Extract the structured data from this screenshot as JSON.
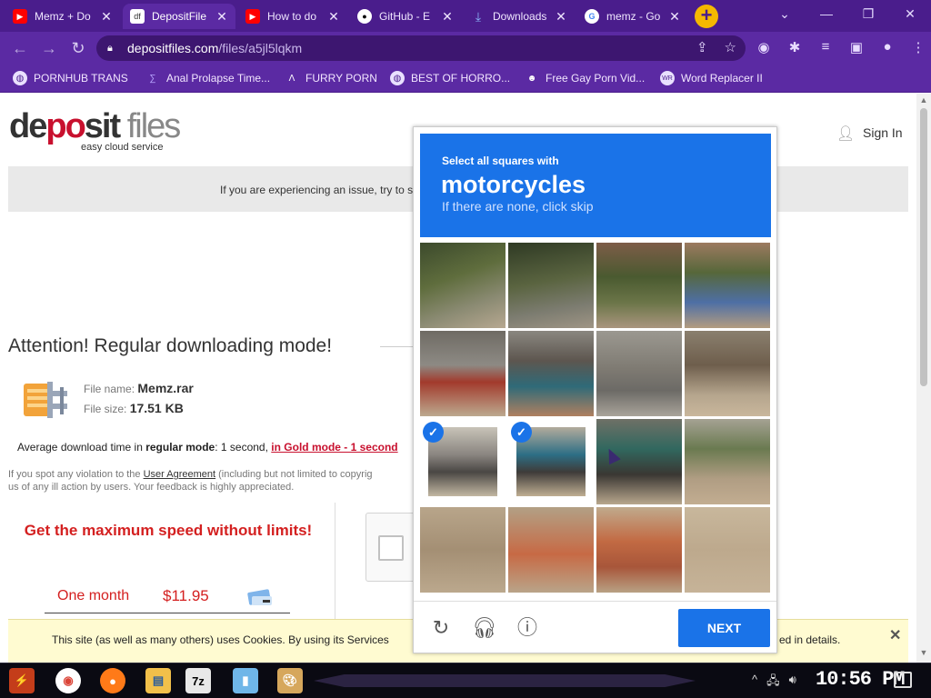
{
  "browser": {
    "tabs": [
      {
        "label": "Memz + Do",
        "icon": "youtube-icon",
        "color": "#ff0000"
      },
      {
        "label": "DepositFile",
        "icon": "depositfiles-icon",
        "color": "#ffffff"
      },
      {
        "label": "How to do",
        "icon": "youtube-icon",
        "color": "#ff0000"
      },
      {
        "label": "GitHub - E",
        "icon": "github-icon",
        "color": "#ffffff"
      },
      {
        "label": "Downloads",
        "icon": "download-icon",
        "color": "#4285f4"
      },
      {
        "label": "memz - Go",
        "icon": "google-icon",
        "color": "#ffffff"
      }
    ],
    "url_domain": "depositfiles.com",
    "url_path": "/files/a5jl5lqkm",
    "bookmarks": [
      {
        "label": "PORNHUB TRANS",
        "icon": "globe-icon"
      },
      {
        "label": "Anal Prolapse Time...",
        "icon": "bookmark-icon"
      },
      {
        "label": "FURRY PORN",
        "icon": "lambda-icon"
      },
      {
        "label": "BEST OF HORRO...",
        "icon": "globe-icon"
      },
      {
        "label": "Free Gay Porn Vid...",
        "icon": "bookmark-icon"
      },
      {
        "label": "Word Replacer II",
        "icon": "extension-icon"
      }
    ]
  },
  "site": {
    "logo_part1": "de",
    "logo_part2": "po",
    "logo_part3": "sit",
    "logo_part4": " files",
    "tagline": "easy cloud service",
    "signin": "Sign In",
    "banner_text": "If you are experiencing an issue, try to s",
    "heading": "Attention! Regular downloading mode!",
    "file_name_label": "File name:",
    "file_name": "Memz.rar",
    "file_size_label": "File size:",
    "file_size": "17.51 KB",
    "avg_prefix": "Average download time in ",
    "avg_mode": "regular mode",
    "avg_mid": ": 1 second, ",
    "avg_gold": "in Gold mode - 1 second",
    "violation_pre": "If you spot any violation to the ",
    "violation_link": "User Agreement",
    "violation_post": " (including but not limited to copyrig",
    "violation_line2": "us of any ill action by users. Your feedback is highly appreciated.",
    "promo": "Get the maximum speed without limits!",
    "plan_name": "One month",
    "plan_price": "$11.95",
    "cookie_text": "This site (as well as many others) uses Cookies. By using its Services",
    "cookie_text2": "ed in details.",
    "cookie_close": "✕"
  },
  "captcha": {
    "line1": "Select all squares with",
    "target": "motorcycles",
    "line3": "If there are none, click skip",
    "next": "NEXT",
    "selected": [
      8,
      9
    ]
  },
  "taskbar": {
    "clock": "10:56 PM"
  }
}
